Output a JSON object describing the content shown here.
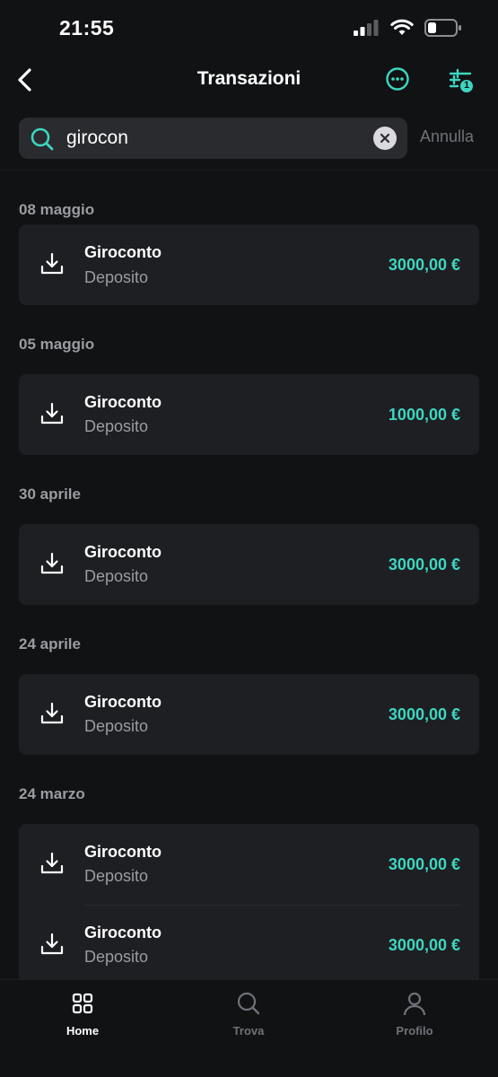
{
  "status": {
    "time": "21:55"
  },
  "header": {
    "title": "Transazioni",
    "filter_badge": "1"
  },
  "search": {
    "value": "girocon",
    "cancel_label": "Annulla"
  },
  "groups": [
    {
      "date": "08 maggio",
      "transactions": [
        {
          "title": "Giroconto",
          "subtitle": "Deposito",
          "amount": "3000,00 €"
        }
      ]
    },
    {
      "date": "05 maggio",
      "transactions": [
        {
          "title": "Giroconto",
          "subtitle": "Deposito",
          "amount": "1000,00 €"
        }
      ]
    },
    {
      "date": "30 aprile",
      "transactions": [
        {
          "title": "Giroconto",
          "subtitle": "Deposito",
          "amount": "3000,00 €"
        }
      ]
    },
    {
      "date": "24 aprile",
      "transactions": [
        {
          "title": "Giroconto",
          "subtitle": "Deposito",
          "amount": "3000,00 €"
        }
      ]
    },
    {
      "date": "24 marzo",
      "transactions": [
        {
          "title": "Giroconto",
          "subtitle": "Deposito",
          "amount": "3000,00 €"
        },
        {
          "title": "Giroconto",
          "subtitle": "Deposito",
          "amount": "3000,00 €"
        }
      ]
    }
  ],
  "tabs": [
    {
      "label": "Home",
      "icon": "grid-icon",
      "active": true
    },
    {
      "label": "Trova",
      "icon": "search-icon",
      "active": false
    },
    {
      "label": "Profilo",
      "icon": "user-icon",
      "active": false
    }
  ],
  "colors": {
    "accent": "#3dd6c0",
    "background": "#111214",
    "card": "#1e1f22",
    "muted": "#9a9ca1"
  }
}
